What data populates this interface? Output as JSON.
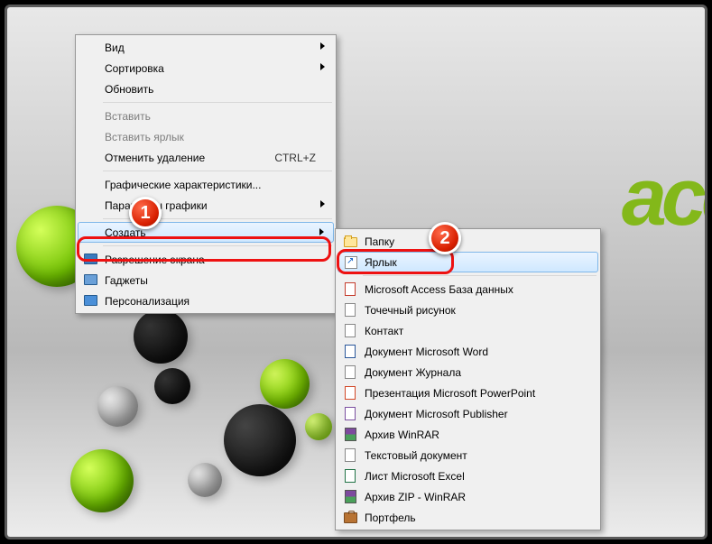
{
  "wallpaper": {
    "brand": "ace"
  },
  "badges": {
    "b1": "1",
    "b2": "2"
  },
  "context_menu": {
    "view": "Вид",
    "sort": "Сортировка",
    "refresh": "Обновить",
    "paste": "Вставить",
    "paste_shortcut": "Вставить ярлык",
    "undo_delete": "Отменить удаление",
    "undo_delete_shortcut": "CTRL+Z",
    "gfx": "Графические характеристики...",
    "gfx_params": "Параметры графики",
    "new": "Создать",
    "resolution": "Разрешение экрана",
    "gadgets": "Гаджеты",
    "personalize": "Персонализация"
  },
  "submenu_new": {
    "folder": "Папку",
    "shortcut": "Ярлык",
    "access": "Microsoft Access База данных",
    "bitmap": "Точечный рисунок",
    "contact": "Контакт",
    "word": "Документ Microsoft Word",
    "journal": "Документ Журнала",
    "powerpoint": "Презентация Microsoft PowerPoint",
    "publisher": "Документ Microsoft Publisher",
    "rar": "Архив WinRAR",
    "text": "Текстовый документ",
    "excel": "Лист Microsoft Excel",
    "zip": "Архив ZIP - WinRAR",
    "briefcase": "Портфель"
  }
}
